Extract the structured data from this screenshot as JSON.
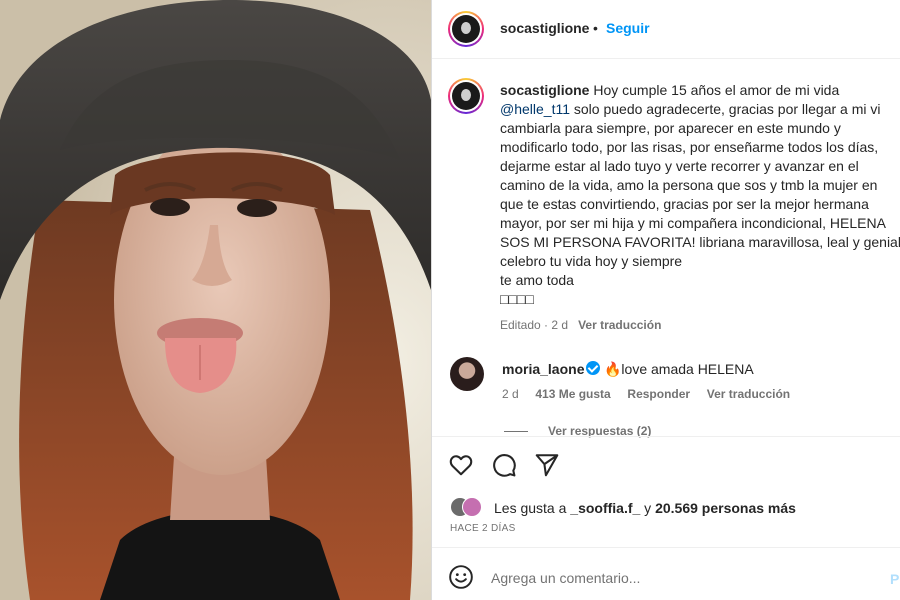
{
  "photo": {
    "alt": ""
  },
  "header": {
    "username": "socastiglione",
    "separator": "•",
    "follow_label": "Seguir"
  },
  "caption": {
    "username": "socastiglione",
    "line1": "Hoy cumple 15 años el amor de mi vida",
    "mention": "@helle_t11",
    "line2_rest": " solo puedo agradecerte, gracias por llegar a mi vi",
    "line3": "cambiarla para siempre, por aparecer en este mundo y",
    "line4": "modificarlo todo, por las risas, por enseñarme todos los días,",
    "line5": "dejarme estar al lado tuyo y verte recorrer y avanzar en el",
    "line6": "camino de la vida, amo la persona que sos y tmb la mujer en",
    "line7": "que te estas convirtiendo, gracias por ser la mejor hermana",
    "line8": "mayor, por ser mi hija y mi compañera incondicional, HELENA",
    "line9": "SOS MI PERSONA FAVORITA! libriana maravillosa, leal y genial",
    "line10": "celebro tu vida hoy y siempre",
    "line11": "te amo toda",
    "line12": "□□□□",
    "edited": "Editado · 2 d",
    "see_translation": "Ver traducción"
  },
  "comment": {
    "username": "moria_laone",
    "text": "🔥love amada HELENA",
    "time": "2 d",
    "likes": "413 Me gusta",
    "reply": "Responder",
    "see_translation": "Ver traducción",
    "more_replies": "Ver respuestas (2)"
  },
  "actions": {
    "like_icon": "heart-icon",
    "comment_icon": "comment-icon",
    "share_icon": "send-icon"
  },
  "likes": {
    "prefix": "Les gusta a ",
    "user": "_sooffia.f_",
    "middle": " y ",
    "count": "20.569 personas más"
  },
  "time_ago": "HACE 2 DÍAS",
  "add_comment": {
    "placeholder": "Agrega un comentario...",
    "post_label": "P"
  },
  "colors": {
    "link_blue": "#0095f6",
    "mention_blue": "#00376b",
    "muted": "#737373",
    "text": "#262626"
  }
}
